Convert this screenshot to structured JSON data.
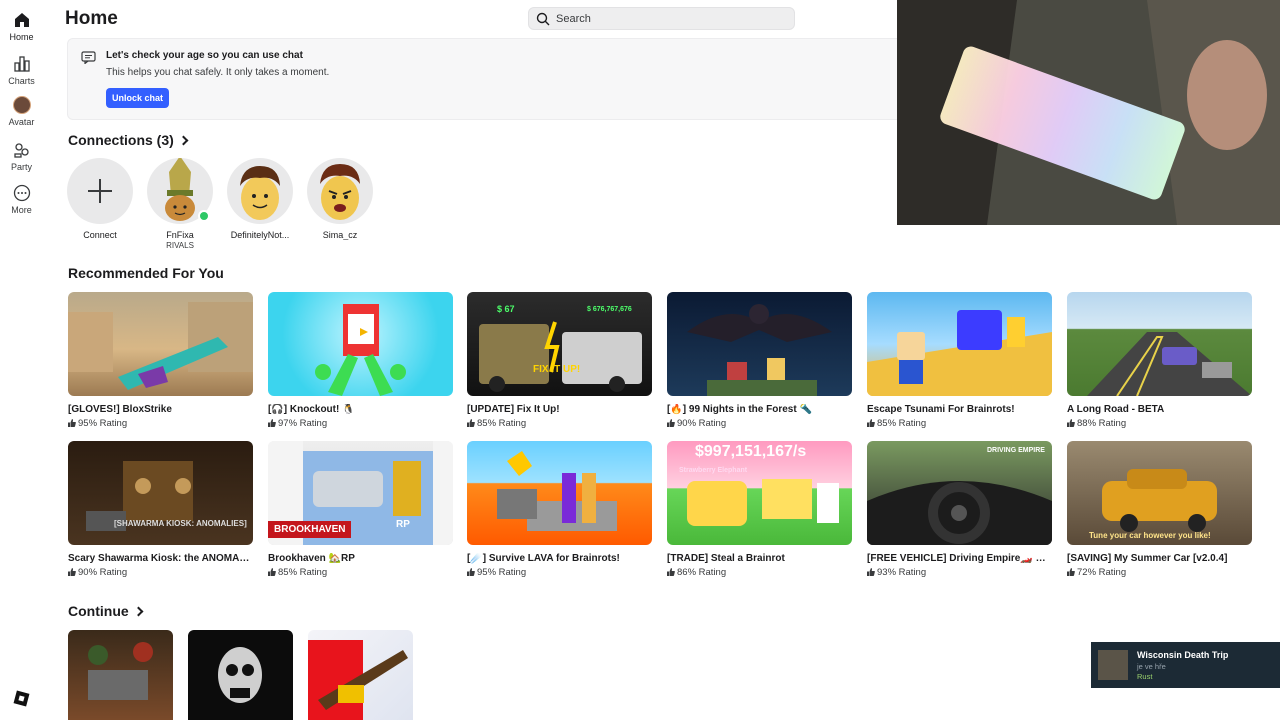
{
  "sidebar": {
    "items": [
      {
        "label": "Home",
        "icon": "home-icon"
      },
      {
        "label": "Charts",
        "icon": "charts-icon"
      },
      {
        "label": "Avatar",
        "icon": "avatar-icon"
      },
      {
        "label": "Party",
        "icon": "party-icon"
      },
      {
        "label": "More",
        "icon": "more-icon"
      }
    ]
  },
  "header": {
    "title": "Home",
    "search_placeholder": "Search"
  },
  "banner": {
    "title": "Let's check your age so you can use chat",
    "subtitle": "This helps you chat safely. It only takes a moment.",
    "button": "Unlock chat"
  },
  "connections": {
    "title": "Connections (3)",
    "items": [
      {
        "name": "Connect",
        "sub": ""
      },
      {
        "name": "FnFixa",
        "sub": "RIVALS"
      },
      {
        "name": "DefinitelyNot...",
        "sub": ""
      },
      {
        "name": "Sima_cz",
        "sub": ""
      }
    ]
  },
  "recommended": {
    "title": "Recommended For You",
    "games": [
      {
        "name": "[GLOVES!] BloxStrike",
        "rating": "95% Rating"
      },
      {
        "name": "[🎧] Knockout! 🐧",
        "rating": "97% Rating"
      },
      {
        "name": "[UPDATE] Fix It Up!",
        "rating": "85% Rating"
      },
      {
        "name": "[🔥] 99 Nights in the Forest 🔦",
        "rating": "90% Rating"
      },
      {
        "name": "Escape Tsunami For Brainrots!",
        "rating": "85% Rating"
      },
      {
        "name": "A Long Road - BETA",
        "rating": "88% Rating"
      },
      {
        "name": "Scary Shawarma Kiosk: the ANOMALY ...",
        "rating": "90% Rating"
      },
      {
        "name": "Brookhaven 🏡RP",
        "rating": "85% Rating"
      },
      {
        "name": "[☄️] Survive LAVA for Brainrots!",
        "rating": "95% Rating"
      },
      {
        "name": "[TRADE] Steal a Brainrot",
        "rating": "86% Rating"
      },
      {
        "name": "[FREE VEHICLE] Driving Empire🏎️ Car ...",
        "rating": "93% Rating"
      },
      {
        "name": "[SAVING] My Summer Car [v2.0.4]",
        "rating": "72% Rating"
      }
    ],
    "thumb_text": {
      "fixitup_money": "$ 67",
      "fixitup_money2": "$ 676,767,676",
      "fixitup_logo": "FIX IT UP!",
      "shawarma": "[SHAWARMA KIOSK: ANOMALIES]",
      "brookhaven": "BROOKHAVEN",
      "brookhaven_rp": "RP",
      "brainrot_money": "$997,151,167/s",
      "brainrot_sub": "Strawberry Elephant",
      "driving": "DRIVING EMPIRE",
      "summercar": "Tune your car however you like!"
    }
  },
  "continue": {
    "title": "Continue"
  },
  "toast": {
    "title": "Wisconsin Death Trip",
    "subtitle": "je ve hře",
    "game": "Rust"
  },
  "colors": {
    "accent": "#335fff",
    "online": "#2ec866"
  }
}
